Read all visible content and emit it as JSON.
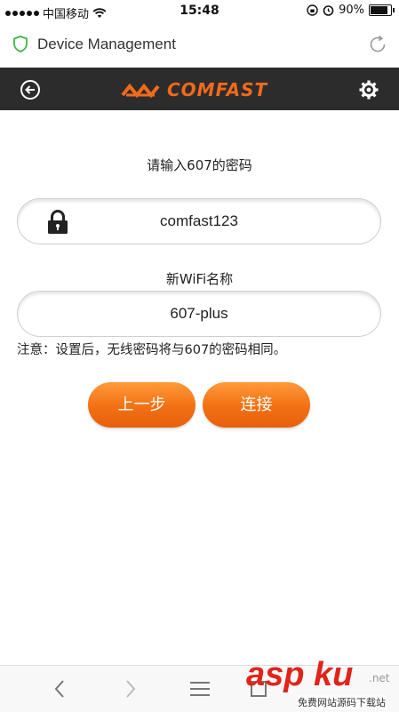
{
  "status_bar": {
    "carrier": "中国移动",
    "time": "15:48",
    "battery": "90%"
  },
  "browser": {
    "title": "Device Management"
  },
  "app_header": {
    "brand": "COMFAST"
  },
  "form": {
    "password_label": "请输入607的密码",
    "password_value": "comfast123",
    "ssid_label": "新WiFi名称",
    "ssid_value": "607-plus",
    "note": "注意：设置后，无线密码将与607的密码相同。",
    "back_button": "上一步",
    "connect_button": "连接"
  },
  "watermark": {
    "brand": "asp ku",
    "sub": "免费网站源码下载站",
    "net": ".net"
  },
  "colors": {
    "accent": "#f27013",
    "header_bg": "#2c2c2c",
    "brand_orange": "#f26a1b"
  }
}
